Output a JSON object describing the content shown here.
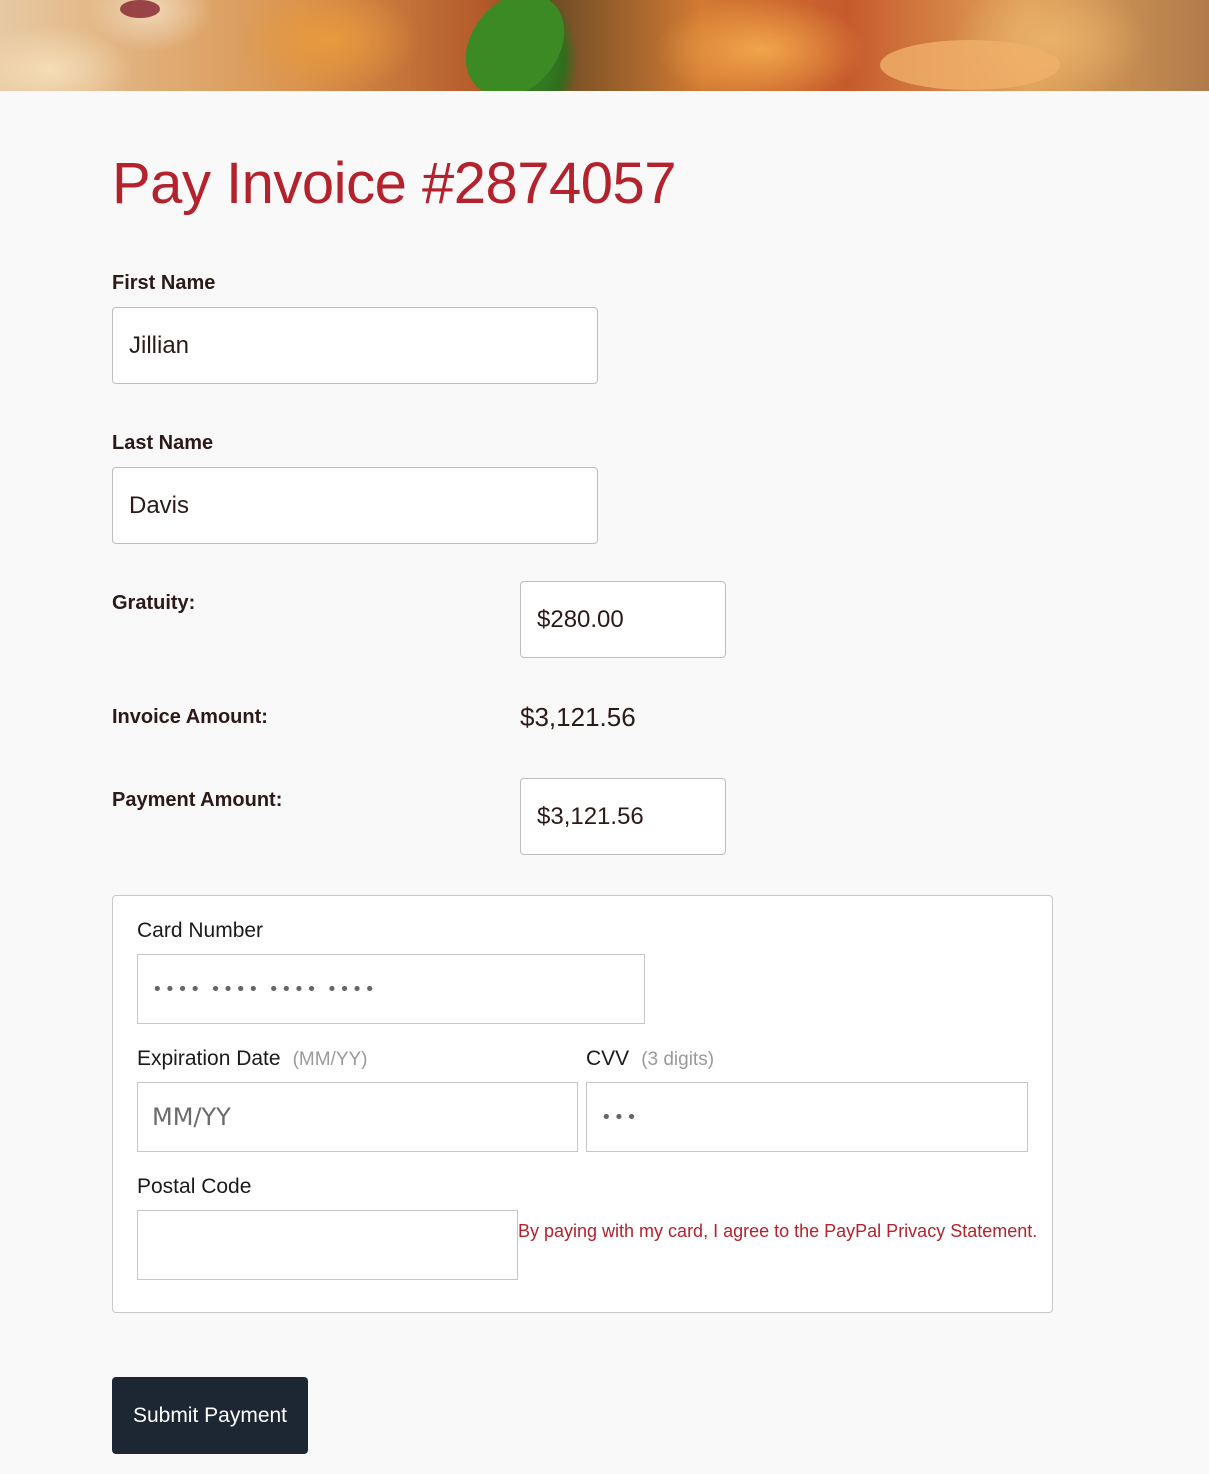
{
  "page": {
    "title": "Pay Invoice #2874057"
  },
  "form": {
    "first_name": {
      "label": "First Name",
      "value": "Jillian"
    },
    "last_name": {
      "label": "Last Name",
      "value": "Davis"
    },
    "gratuity": {
      "label": "Gratuity:",
      "value": "$280.00"
    },
    "invoice_amount": {
      "label": "Invoice Amount:",
      "value": "$3,121.56"
    },
    "payment_amount": {
      "label": "Payment Amount:",
      "value": "$3,121.56"
    }
  },
  "card": {
    "number": {
      "label": "Card Number",
      "placeholder": "•••• •••• •••• ••••"
    },
    "expiration": {
      "label": "Expiration Date",
      "hint": "(MM/YY)",
      "placeholder": "MM/YY"
    },
    "cvv": {
      "label": "CVV",
      "hint": "(3 digits)",
      "placeholder": "•••"
    },
    "postal": {
      "label": "Postal Code",
      "value": ""
    },
    "privacy_text": "By paying with my card, I agree to the PayPal Privacy Statement."
  },
  "actions": {
    "submit_label": "Submit Payment"
  },
  "colors": {
    "accent": "#b3222d",
    "button": "#1c2733",
    "background": "#f9f9f9"
  }
}
